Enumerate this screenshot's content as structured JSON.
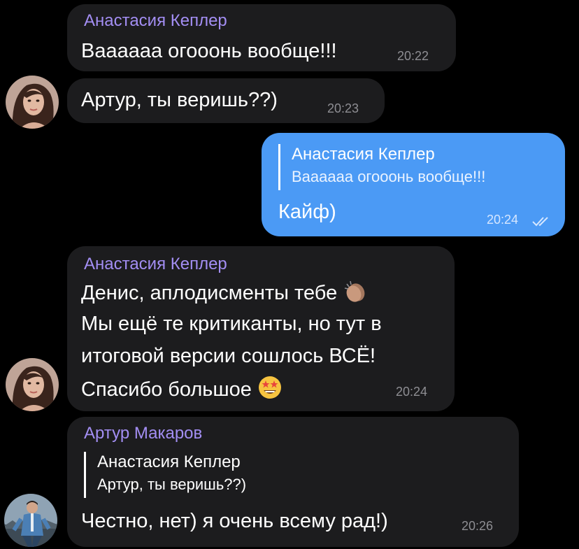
{
  "messages": [
    {
      "sender": "Анастасия Кеплер",
      "text": "Ваааааа огооонь вообще!!!",
      "time": "20:22"
    },
    {
      "text": "Артур, ты веришь??)",
      "time": "20:23"
    },
    {
      "reply_name": "Анастасия Кеплер",
      "reply_text": "Ваааааа огооонь вообще!!!",
      "text": "Кайф)",
      "time": "20:24"
    },
    {
      "sender": "Анастасия Кеплер",
      "lines": [
        "Денис, аплодисменты тебе",
        "Мы ещё те критиканты, но тут в",
        "итоговой версии сошлось ВСЁ!",
        "Спасибо большое"
      ],
      "time": "20:24"
    },
    {
      "sender": "Артур Макаров",
      "reply_name": "Анастасия Кеплер",
      "reply_text": "Артур, ты веришь??)",
      "text": "Честно, нет) я очень всему рад!)",
      "time": "20:26"
    }
  ],
  "icons": {
    "clap": "clapping-hands-emoji",
    "star_struck": "star-struck-emoji",
    "read_receipt": "double-check-icon"
  },
  "colors": {
    "background": "#000000",
    "incoming_bubble": "#1c1c1e",
    "outgoing_bubble": "#4b9af5",
    "sender_name": "#a38ef3",
    "timestamp": "#8e8e93"
  }
}
